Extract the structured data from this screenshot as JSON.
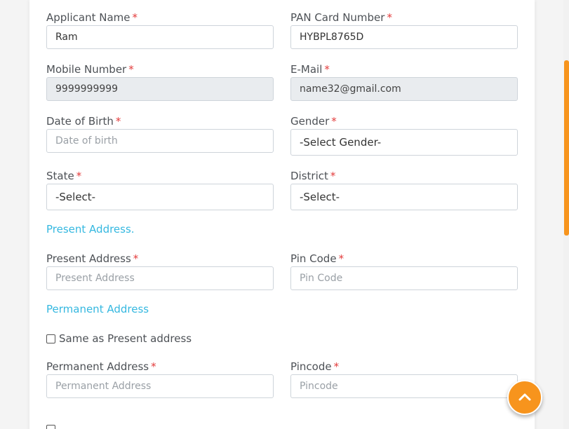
{
  "form": {
    "applicant_name": {
      "label": "Applicant Name",
      "required": "*",
      "value": "Ram"
    },
    "pan": {
      "label": "PAN Card Number",
      "required": "*",
      "value": "HYBPL8765D"
    },
    "mobile": {
      "label": "Mobile Number",
      "required": "*",
      "value": "9999999999"
    },
    "email": {
      "label": "E-Mail",
      "required": "*",
      "value": "name32@gmail.com"
    },
    "dob": {
      "label": "Date of Birth",
      "required": "*",
      "placeholder": "Date of birth"
    },
    "gender": {
      "label": "Gender",
      "required": "*",
      "selected": "-Select Gender-"
    },
    "state": {
      "label": "State",
      "required": "*",
      "selected": "-Select-"
    },
    "district": {
      "label": "District",
      "required": "*",
      "selected": "-Select-"
    },
    "present_section_title": "Present Address.",
    "present_address": {
      "label": "Present Address",
      "required": "*",
      "placeholder": "Present Address"
    },
    "pin_code": {
      "label": "Pin Code",
      "required": "*",
      "placeholder": "Pin Code"
    },
    "permanent_section_title": "Permanent Address",
    "same_as_present": {
      "label": "Same as Present address",
      "checked": false
    },
    "permanent_address": {
      "label": "Permanent Address",
      "required": "*",
      "placeholder": "Permanent Address"
    },
    "pincode": {
      "label": "Pincode",
      "required": "*",
      "placeholder": "Pincode"
    }
  },
  "icons": {
    "scroll_top": "chevron-up-icon"
  },
  "colors": {
    "accent": "#f7941d",
    "section_title": "#35b8e0",
    "required": "#e33b3b",
    "readonly_bg": "#e9ecef"
  }
}
